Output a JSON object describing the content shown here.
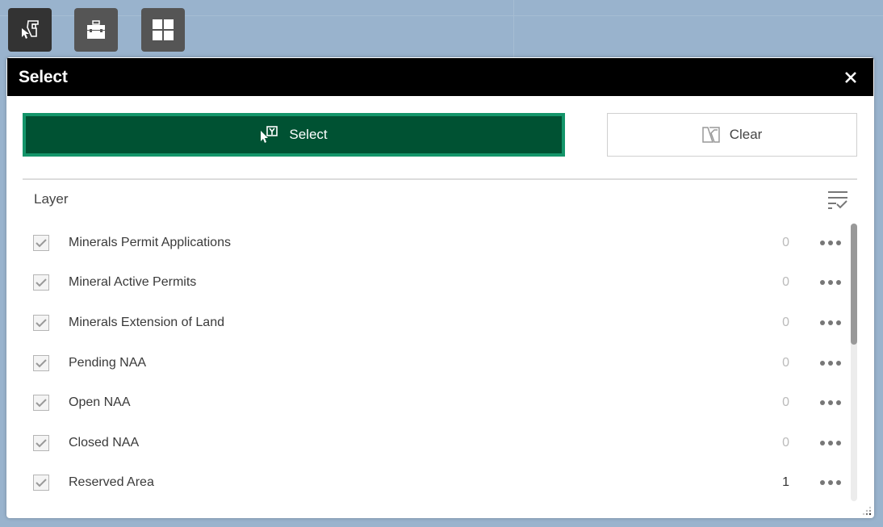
{
  "toolbar": {
    "buttons": [
      {
        "name": "select-tool",
        "icon": "select-cursor-icon",
        "active": true
      },
      {
        "name": "toolbox",
        "icon": "toolbox-icon",
        "active": false
      },
      {
        "name": "widgets-grid",
        "icon": "grid-icon",
        "active": false
      }
    ]
  },
  "panel": {
    "title": "Select",
    "close_icon": "close-icon",
    "select_button": {
      "label": "Select",
      "icon": "select-cursor-icon"
    },
    "clear_button": {
      "label": "Clear",
      "icon": "clear-selection-icon"
    },
    "layer_header": "Layer",
    "sort_icon": "filter-check-icon",
    "layers": [
      {
        "label": "Minerals Permit Applications",
        "checked": true,
        "count": "0"
      },
      {
        "label": "Mineral Active Permits",
        "checked": true,
        "count": "0"
      },
      {
        "label": "Minerals Extension of Land",
        "checked": true,
        "count": "0"
      },
      {
        "label": "Pending NAA",
        "checked": true,
        "count": "0"
      },
      {
        "label": "Open NAA",
        "checked": true,
        "count": "0"
      },
      {
        "label": "Closed NAA",
        "checked": true,
        "count": "0"
      },
      {
        "label": "Reserved Area",
        "checked": true,
        "count": "1"
      }
    ],
    "more_icon": "more-dots-icon"
  },
  "colors": {
    "map_background": "#99b3cd",
    "header_bg": "#000000",
    "select_bg": "#005233",
    "select_border": "#14956a"
  }
}
